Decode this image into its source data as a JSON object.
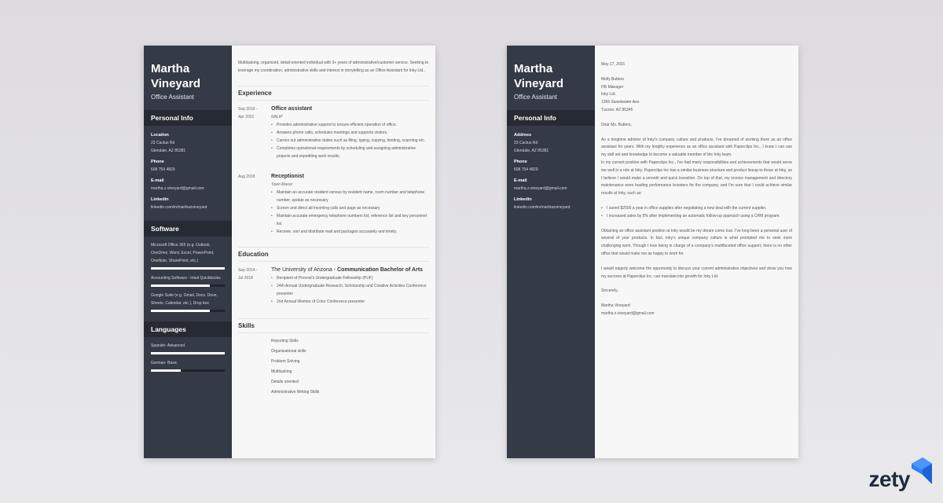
{
  "resume": {
    "name_line1": "Martha",
    "name_line2": "Vineyard",
    "role": "Office Assistant",
    "personal_info_title": "Personal Info",
    "personal_info": [
      {
        "label": "Location",
        "values": [
          "23 Cactus Rd",
          "Glendale, AZ 85381"
        ]
      },
      {
        "label": "Phone",
        "values": [
          "608 754 4829"
        ]
      },
      {
        "label": "E-mail",
        "values": [
          "martha.z.vineyard@gmail.com"
        ]
      },
      {
        "label": "Linkedin",
        "values": [
          "linkedin.com/in/marthazvineyard"
        ]
      }
    ],
    "software_title": "Software",
    "software": [
      {
        "text": "Microsoft Office 365 (e.g. Outlook, OneDrive, Word, Excel, PowerPoint, OneNote, SharePoint, etc.)",
        "level": 1.0
      },
      {
        "text": "Accounting Software - Intuit Quickbooks",
        "level": 0.8
      },
      {
        "text": "Google Suite (e.g. Gmail, Docs, Drive, Sheets, Calendar, etc.), Drop box",
        "level": 0.8
      }
    ],
    "languages_title": "Languages",
    "languages": [
      {
        "text": "Spanish- Advanced",
        "level": 1.0
      },
      {
        "text": "German- Basic",
        "level": 0.4
      }
    ],
    "summary": "Multitasking, organized, detail-oriented individual with 3+ years of administrative/customer service. Seeking to leverage my coordination, administrative skills and interest in storytelling as an Office Assistant for Inky Ltd..",
    "experience_title": "Experience",
    "experience": [
      {
        "date_line1": "Sep 2019 -",
        "date_line2": "Apr 2021",
        "title": "Office assistant",
        "org": "NALIP",
        "bullets": [
          "Provides administrative support to ensure efficient operation of office.",
          "Answers phone calls, schedules meetings and supports visitors.",
          "Carries out administrative duties such as filing, typing, copying, binding, scanning etc.",
          "Completes operational requirements by scheduling and assigning administrative projects and expediting work results."
        ]
      },
      {
        "date_line1": "Aug 2018",
        "date_line2": "",
        "title": "Receptionist",
        "org": "Town Manor",
        "bullets": [
          "Maintain an accurate resident census by resident name, room number and telephone number, update as necessary",
          "Screen and direct all incoming calls and page as necessary",
          "Maintain accurate emergency telephone numbers list, reference list and key personnel list",
          "Receive, sort and distribute mail and packages accurately and timely."
        ]
      }
    ],
    "education_title": "Education",
    "education": {
      "date_line1": "Sep 2014 -",
      "date_line2": "Jul 2018",
      "school": "The University of Arizona - ",
      "degree": "Communication Bachelor of Arts",
      "bullets": [
        "Recipient of Provost's Undergraduate Fellowship (PUF)",
        "24th Annual Undergraduate Research, Scholarship and Creative Activities Conference presenter",
        "2nd Annual Women of Color Conference presenter"
      ]
    },
    "skills_title": "Skills",
    "skills": [
      "Reporting Skills",
      "Organizational skills",
      "Problem Solving",
      "Multitasking",
      "Details oriented",
      "Administrative Writing Skills"
    ]
  },
  "letter": {
    "name_line1": "Martha",
    "name_line2": "Vineyard",
    "role": "Office Assistant",
    "personal_info_title": "Personal Info",
    "personal_info": [
      {
        "label": "Address",
        "values": [
          "23 Cactus Rd",
          "Glendale, AZ 85381"
        ]
      },
      {
        "label": "Phone",
        "values": [
          "608 754 4829"
        ]
      },
      {
        "label": "E-mail",
        "values": [
          "martha.z.vineyard@gmail.com"
        ]
      },
      {
        "label": "Linkedin",
        "values": [
          "linkedin.com/in/marthazvineyard"
        ]
      }
    ],
    "date": "May 17, 2021",
    "recipient": [
      "Molly Butters",
      "HR Manager",
      "Inky Ltd.",
      "1356 Sweetwater Ave.",
      "Tucson, AZ 85345"
    ],
    "salutation": "Dear Ms. Butters,",
    "paragraph1": "As a longtime admirer of Inky's company culture and products, I've dreamed of working there as an office assistant for years. With my lengthy experience as an office assistant with Paperclips Inc., I know I can use my skill set and knowledge to become a valuable member of the Inky team.",
    "paragraph2": "In my current position with Paperclips Inc., I've had many responsibilities and achievements that would serve me well in a role at Inky. Paperclips Inc has a similar business structure and product lineup to those at Inky, so I believe I would make a smooth and quick transition. On top of that, my invoice management and directory maintenance were leading performance boosters for the company, and I'm sure that I could achieve similar results at Inky, such as:",
    "bullets": [
      "I saved $2500 a year in office supplies after negotiating a new deal with the current supplier.",
      "I increased sales by 5% after implementing an automatic follow-up approach using a CRM program."
    ],
    "paragraph3": "Obtaining an office assistant position at Inky would be my dream come true. I've long been a personal user of several of your products. In fact, Inky's unique company culture is what prompted me to seek more challenging work. Though I love being in charge of a company's multifaceted office support, there is no other office that would make me as happy to work for.",
    "paragraph4": "I would eagerly welcome the opportunity to discuss your current administrative objectives and show you how my success at Paperclips Inc. can translate into growth for Inky Ltd.",
    "closing": "Sincerely,",
    "signature_name": "Martha Vineyard",
    "signature_email": "martha.z.vineyard@gmail.com"
  },
  "brand": {
    "logo_text": "zety",
    "logo_color": "#1f2a3c",
    "accent_color": "#2d7ff9"
  }
}
